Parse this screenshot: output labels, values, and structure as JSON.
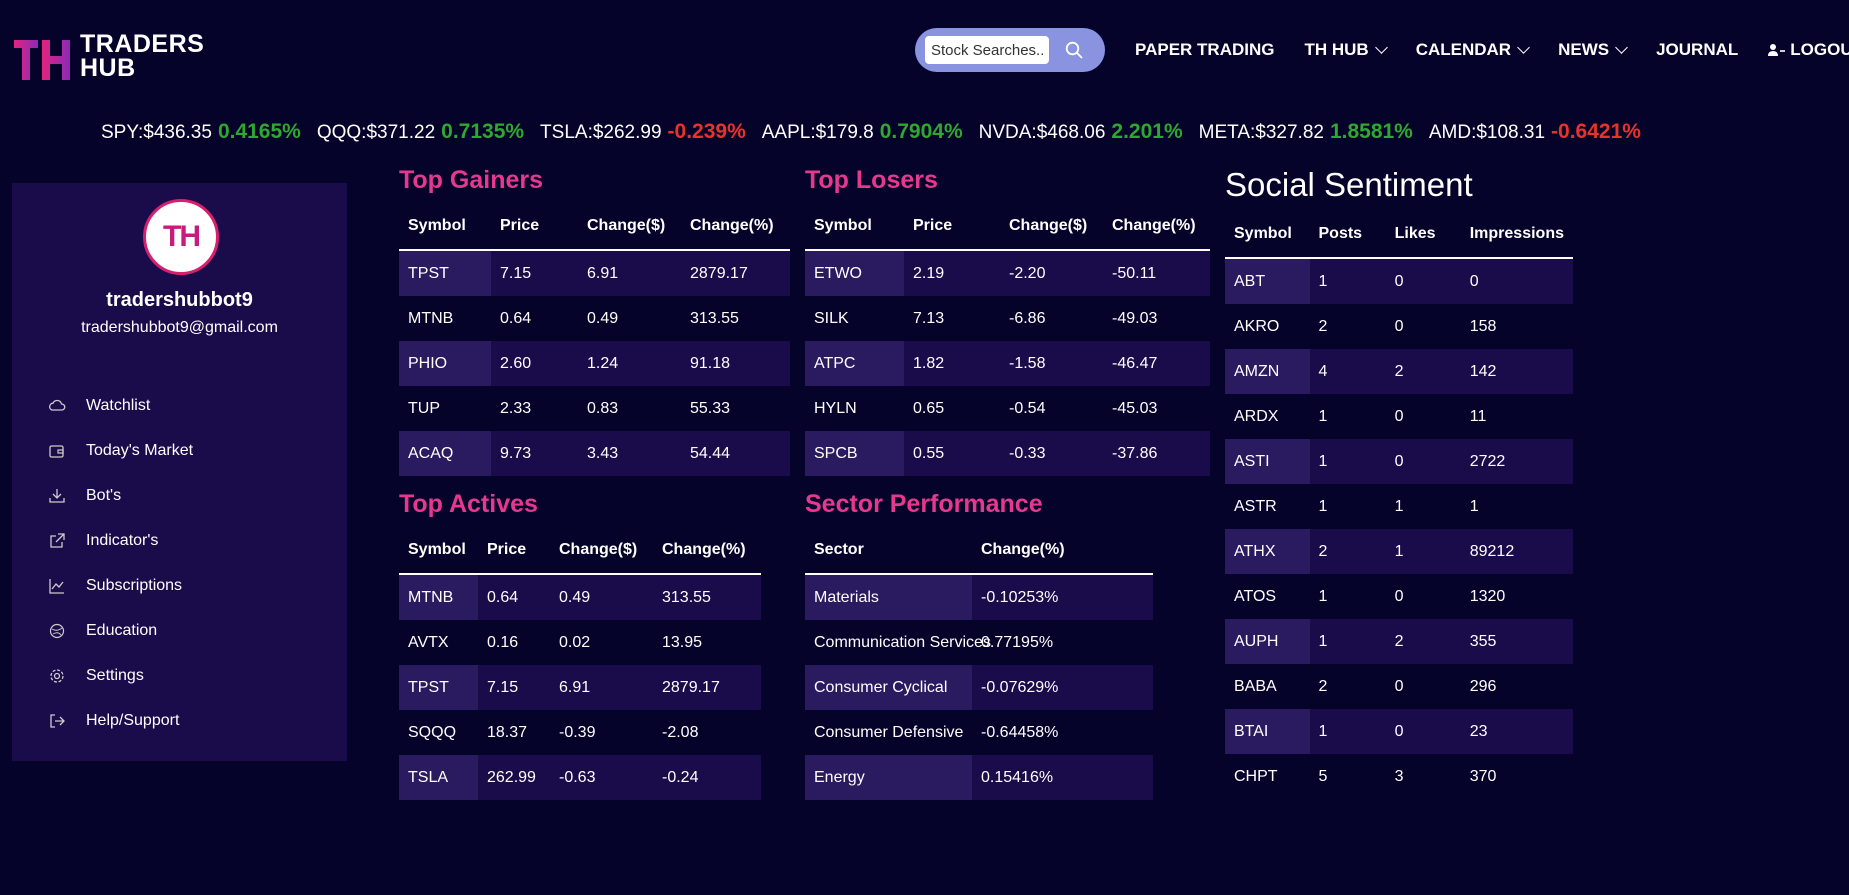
{
  "header": {
    "logo_text_line1": "TRADERS",
    "logo_text_line2": "HUB",
    "logo_mark": "TH",
    "search_placeholder": "Stock Searches....",
    "nav": [
      {
        "label": "PAPER TRADING",
        "dropdown": false
      },
      {
        "label": "TH HUB",
        "dropdown": true
      },
      {
        "label": "CALENDAR",
        "dropdown": true
      },
      {
        "label": "NEWS",
        "dropdown": true
      },
      {
        "label": "JOURNAL",
        "dropdown": false
      },
      {
        "label": "LOGOUT",
        "dropdown": false,
        "icon": "user-logout-icon"
      }
    ]
  },
  "ticker": [
    {
      "sym": "SPY:$436.35",
      "chg": "0.4165%",
      "color": "#2ea82e"
    },
    {
      "sym": "QQQ:$371.22",
      "chg": "0.7135%",
      "color": "#2ea82e"
    },
    {
      "sym": "TSLA:$262.99",
      "chg": "-0.239%",
      "color": "#e8332a"
    },
    {
      "sym": "AAPL:$179.8",
      "chg": "0.7904%",
      "color": "#2ea82e"
    },
    {
      "sym": "NVDA:$468.06",
      "chg": "2.201%",
      "color": "#2ea82e"
    },
    {
      "sym": "META:$327.82",
      "chg": "1.8581%",
      "color": "#2ea82e"
    },
    {
      "sym": "AMD:$108.31",
      "chg": "-0.6421%",
      "color": "#e8332a"
    }
  ],
  "profile": {
    "avatar_text": "TH",
    "username": "tradershubbot9",
    "email": "tradershubbot9@gmail.com",
    "menu": [
      {
        "label": "Watchlist",
        "icon": "cloud-icon"
      },
      {
        "label": "Today's Market",
        "icon": "wallet-icon"
      },
      {
        "label": "Bot's",
        "icon": "download-icon"
      },
      {
        "label": "Indicator's",
        "icon": "external-link-icon"
      },
      {
        "label": "Subscriptions",
        "icon": "line-chart-icon"
      },
      {
        "label": "Education",
        "icon": "globe-icon"
      },
      {
        "label": "Settings",
        "icon": "gear-icon"
      },
      {
        "label": "Help/Support",
        "icon": "sign-out-icon"
      }
    ]
  },
  "top_gainers": {
    "title": "Top Gainers",
    "headers": [
      "Symbol",
      "Price",
      "Change($)",
      "Change(%)"
    ],
    "rows": [
      [
        "TPST",
        "7.15",
        "6.91",
        "2879.17"
      ],
      [
        "MTNB",
        "0.64",
        "0.49",
        "313.55"
      ],
      [
        "PHIO",
        "2.60",
        "1.24",
        "91.18"
      ],
      [
        "TUP",
        "2.33",
        "0.83",
        "55.33"
      ],
      [
        "ACAQ",
        "9.73",
        "3.43",
        "54.44"
      ]
    ]
  },
  "top_losers": {
    "title": "Top Losers",
    "headers": [
      "Symbol",
      "Price",
      "Change($)",
      "Change(%)"
    ],
    "rows": [
      [
        "ETWO",
        "2.19",
        "-2.20",
        "-50.11"
      ],
      [
        "SILK",
        "7.13",
        "-6.86",
        "-49.03"
      ],
      [
        "ATPC",
        "1.82",
        "-1.58",
        "-46.47"
      ],
      [
        "HYLN",
        "0.65",
        "-0.54",
        "-45.03"
      ],
      [
        "SPCB",
        "0.55",
        "-0.33",
        "-37.86"
      ]
    ]
  },
  "top_actives": {
    "title": "Top Actives",
    "headers": [
      "Symbol",
      "Price",
      "Change($)",
      "Change(%)"
    ],
    "rows": [
      [
        "MTNB",
        "0.64",
        "0.49",
        "313.55"
      ],
      [
        "AVTX",
        "0.16",
        "0.02",
        "13.95"
      ],
      [
        "TPST",
        "7.15",
        "6.91",
        "2879.17"
      ],
      [
        "SQQQ",
        "18.37",
        "-0.39",
        "-2.08"
      ],
      [
        "TSLA",
        "262.99",
        "-0.63",
        "-0.24"
      ]
    ]
  },
  "sector_performance": {
    "title": "Sector Performance",
    "headers": [
      "Sector",
      "Change(%)"
    ],
    "rows": [
      [
        "Materials",
        "-0.10253%"
      ],
      [
        "Communication Services",
        "0.77195%"
      ],
      [
        "Consumer Cyclical",
        "-0.07629%"
      ],
      [
        "Consumer Defensive",
        "-0.64458%"
      ],
      [
        "Energy",
        "0.15416%"
      ]
    ]
  },
  "social_sentiment": {
    "title": "Social Sentiment",
    "headers": [
      "Symbol",
      "Posts",
      "Likes",
      "Impressions"
    ],
    "rows": [
      [
        "ABT",
        "1",
        "0",
        "0"
      ],
      [
        "AKRO",
        "2",
        "0",
        "158"
      ],
      [
        "AMZN",
        "4",
        "2",
        "142"
      ],
      [
        "ARDX",
        "1",
        "0",
        "11"
      ],
      [
        "ASTI",
        "1",
        "0",
        "2722"
      ],
      [
        "ASTR",
        "1",
        "1",
        "1"
      ],
      [
        "ATHX",
        "2",
        "1",
        "89212"
      ],
      [
        "ATOS",
        "1",
        "0",
        "1320"
      ],
      [
        "AUPH",
        "1",
        "2",
        "355"
      ],
      [
        "BABA",
        "2",
        "0",
        "296"
      ],
      [
        "BTAI",
        "1",
        "0",
        "23"
      ],
      [
        "CHPT",
        "5",
        "3",
        "370"
      ]
    ]
  }
}
